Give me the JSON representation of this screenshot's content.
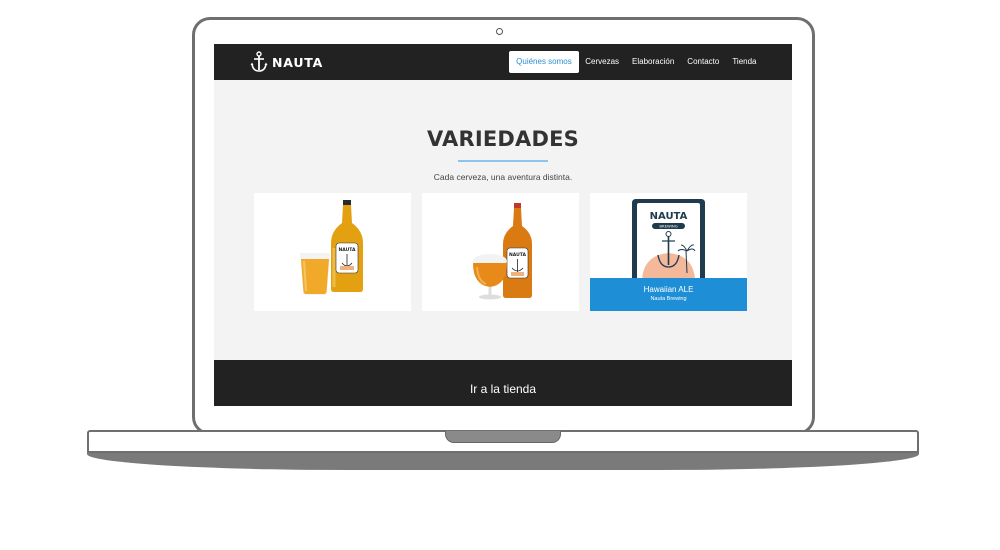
{
  "brand": {
    "name": "NAUTA",
    "logo_icon": "anchor-icon"
  },
  "nav": {
    "items": [
      {
        "label": "Quiénes somos",
        "active": true
      },
      {
        "label": "Cervezas",
        "active": false
      },
      {
        "label": "Elaboración",
        "active": false
      },
      {
        "label": "Contacto",
        "active": false
      },
      {
        "label": "Tienda",
        "active": false
      }
    ]
  },
  "section": {
    "title": "VARIEDADES",
    "subtitle": "Cada cerveza, una aventura distinta."
  },
  "cards": [
    {
      "image": "beer-bottle-with-glass-photo"
    },
    {
      "image": "beer-bottle-with-snifter-glass-photo"
    },
    {
      "image": "nauta-brewing-hawaiian-label",
      "label_brand": "NAUTA",
      "label_sub": "BREWING",
      "name": "Hawaiian ALE",
      "brewery": "Nauta Brewing"
    }
  ],
  "footer": {
    "shop_label": "Ir a la tienda"
  },
  "colors": {
    "accent": "#1e8fd6",
    "navbar": "#222222",
    "background": "#f3f3f3"
  }
}
